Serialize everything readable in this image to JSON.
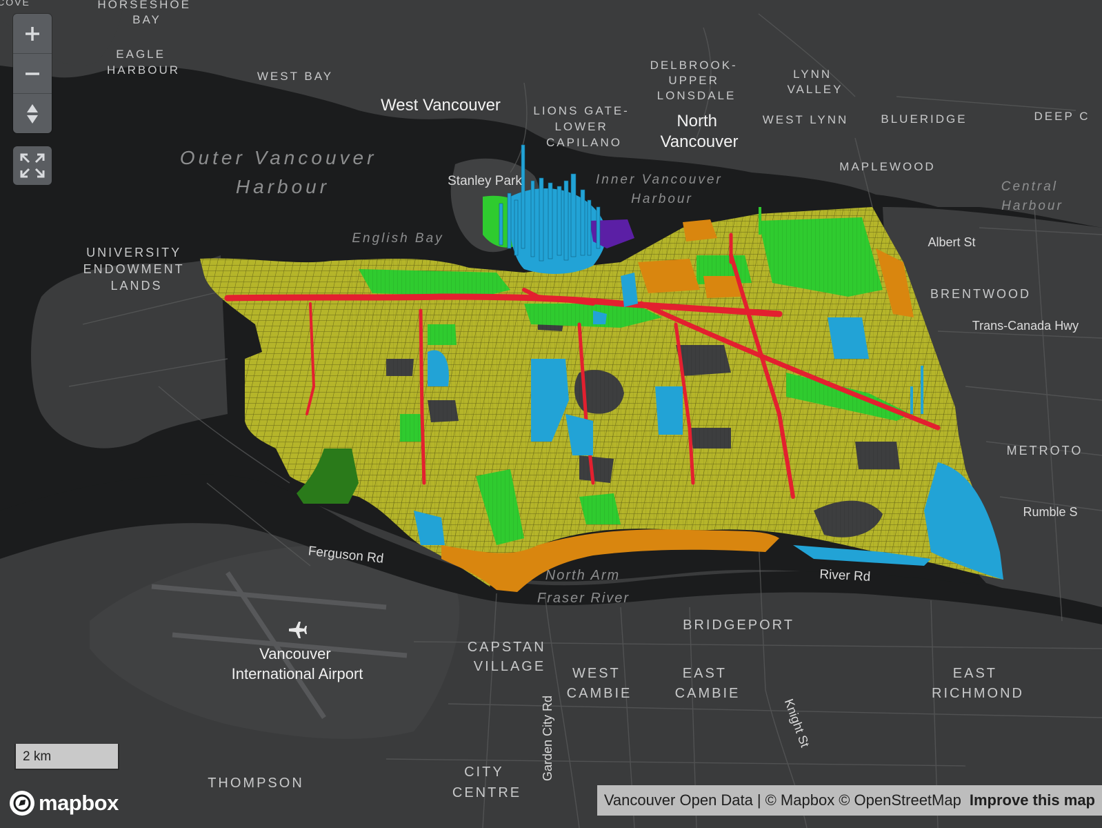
{
  "map": {
    "labels": {
      "cove": "COVE",
      "horseshoe_bay": [
        "HORSESHOE",
        "BAY"
      ],
      "eagle_harbour": [
        "EAGLE",
        "HARBOUR"
      ],
      "west_bay": "WEST BAY",
      "west_vancouver": "West Vancouver",
      "delbrook": [
        "DELBROOK-",
        "UPPER",
        "LONSDALE"
      ],
      "lynn_valley": [
        "LYNN",
        "VALLEY"
      ],
      "lions_gate": [
        "LIONS GATE-",
        "LOWER",
        "CAPILANO"
      ],
      "north_vancouver": [
        "North",
        "Vancouver"
      ],
      "west_lynn": "WEST LYNN",
      "blueridge": "BLUERIDGE",
      "deep_cove": "DEEP C",
      "outer_harbour": [
        "Outer Vancouver",
        "Harbour"
      ],
      "maplewood": "MAPLEWOOD",
      "stanley_park": "Stanley Park",
      "inner_harbour": [
        "Inner Vancouver",
        "Harbour"
      ],
      "central_harbour": [
        "Central",
        "Harbour"
      ],
      "english_bay": "English Bay",
      "university_endowment": [
        "UNIVERSITY",
        "ENDOWMENT",
        "LANDS"
      ],
      "albert_st": "Albert St",
      "brentwood": "BRENTWOOD",
      "trans_canada": "Trans-Canada Hwy",
      "metrotown": "METROTO",
      "rumble": "Rumble S",
      "ferguson_rd": "Ferguson Rd",
      "north_arm": "North Arm",
      "fraser_river": "Fraser River",
      "river_rd": "River Rd",
      "bridgeport": "BRIDGEPORT",
      "capstan_village": [
        "CAPSTAN",
        "VILLAGE"
      ],
      "west_cambie": [
        "WEST",
        "CAMBIE"
      ],
      "east_cambie": [
        "EAST",
        "CAMBIE"
      ],
      "east_richmond": [
        "EAST",
        "RICHMOND"
      ],
      "airport": [
        "Vancouver",
        "International Airport"
      ],
      "thompson": "THOMPSON",
      "city_centre": [
        "CITY",
        "CENTRE"
      ],
      "garden_city_rd": "Garden City Rd",
      "knight_st": "Knight St"
    },
    "zoning_colors": {
      "residential_single": "#b5b52a",
      "residential_multi": "#2fcb2f",
      "commercial": "#e3202f",
      "comprehensive": "#22a3d6",
      "industrial": "#d9860f",
      "agricultural": "#2a7a1a",
      "downtown_special": "#5b1fa5"
    }
  },
  "controls": {
    "zoom_in_icon": "plus-icon",
    "zoom_out_icon": "minus-icon",
    "compass_icon": "compass-icon",
    "fullscreen_icon": "fullscreen-icon"
  },
  "scale": {
    "label": "2 km"
  },
  "logo": {
    "text": "mapbox"
  },
  "attribution": {
    "source": "Vancouver Open Data",
    "separator": "|",
    "mapbox": "© Mapbox",
    "osm": "© OpenStreetMap",
    "improve": "Improve this map"
  }
}
